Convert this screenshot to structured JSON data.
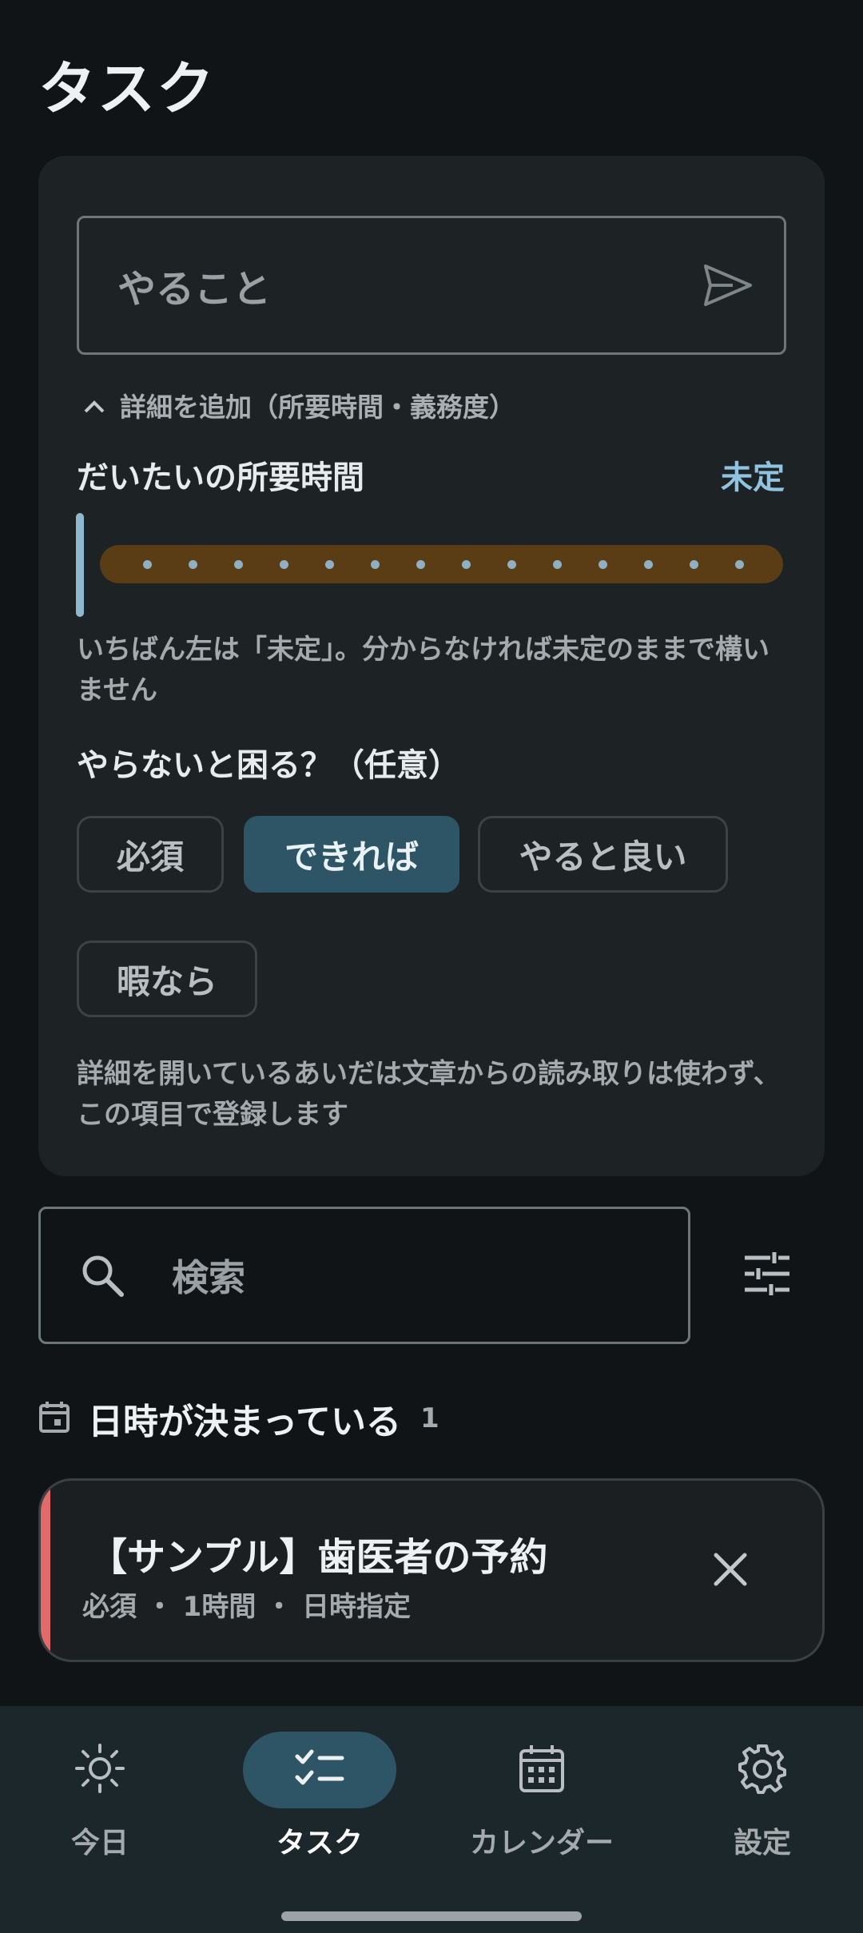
{
  "header": {
    "title": "タスク"
  },
  "form": {
    "todo_placeholder": "やること",
    "details_toggle_label": "詳細を追加（所要時間・義務度）",
    "duration": {
      "label": "だいたいの所要時間",
      "value_label": "未定",
      "slider_value": 0,
      "tick_count": 14,
      "hint": "いちばん左は「未定」。分からなければ未定のままで構いません"
    },
    "obligation": {
      "label": "やらないと困る？（任意）",
      "options": [
        "必須",
        "できれば",
        "やると良い",
        "暇なら"
      ],
      "selected": "できれば"
    },
    "footer_note": "詳細を開いているあいだは文章からの読み取りは使わず、この項目で登録します"
  },
  "search": {
    "placeholder": "検索"
  },
  "groups": [
    {
      "title": "日時が決まっている",
      "count": "1",
      "tasks": [
        {
          "title": "【サンプル】歯医者の予約",
          "meta": "必須 ・ 1時間 ・ 日時指定",
          "accent_color": "#e36a6a"
        }
      ]
    }
  ],
  "bottom_nav": {
    "items": [
      {
        "label": "今日",
        "icon": "sun-icon",
        "active": false
      },
      {
        "label": "タスク",
        "icon": "checklist-icon",
        "active": true
      },
      {
        "label": "カレンダー",
        "icon": "calendar-icon",
        "active": false
      },
      {
        "label": "設定",
        "icon": "gear-icon",
        "active": false
      }
    ]
  },
  "colors": {
    "background": "#111416",
    "card": "#1d2224",
    "accent": "#8fc3e0",
    "selected_chip": "#2d5565",
    "slider_track": "#5a3d14",
    "task_accent": "#e36a6a"
  }
}
